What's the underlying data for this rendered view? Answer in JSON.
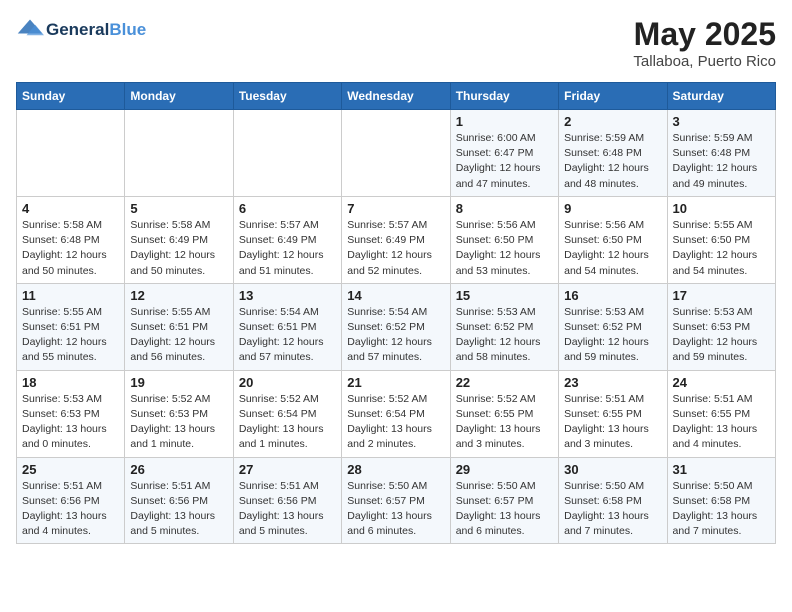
{
  "header": {
    "logo_line1": "General",
    "logo_line2": "Blue",
    "month": "May 2025",
    "location": "Tallaboa, Puerto Rico"
  },
  "weekdays": [
    "Sunday",
    "Monday",
    "Tuesday",
    "Wednesday",
    "Thursday",
    "Friday",
    "Saturday"
  ],
  "weeks": [
    [
      {
        "day": "",
        "info": ""
      },
      {
        "day": "",
        "info": ""
      },
      {
        "day": "",
        "info": ""
      },
      {
        "day": "",
        "info": ""
      },
      {
        "day": "1",
        "info": "Sunrise: 6:00 AM\nSunset: 6:47 PM\nDaylight: 12 hours\nand 47 minutes."
      },
      {
        "day": "2",
        "info": "Sunrise: 5:59 AM\nSunset: 6:48 PM\nDaylight: 12 hours\nand 48 minutes."
      },
      {
        "day": "3",
        "info": "Sunrise: 5:59 AM\nSunset: 6:48 PM\nDaylight: 12 hours\nand 49 minutes."
      }
    ],
    [
      {
        "day": "4",
        "info": "Sunrise: 5:58 AM\nSunset: 6:48 PM\nDaylight: 12 hours\nand 50 minutes."
      },
      {
        "day": "5",
        "info": "Sunrise: 5:58 AM\nSunset: 6:49 PM\nDaylight: 12 hours\nand 50 minutes."
      },
      {
        "day": "6",
        "info": "Sunrise: 5:57 AM\nSunset: 6:49 PM\nDaylight: 12 hours\nand 51 minutes."
      },
      {
        "day": "7",
        "info": "Sunrise: 5:57 AM\nSunset: 6:49 PM\nDaylight: 12 hours\nand 52 minutes."
      },
      {
        "day": "8",
        "info": "Sunrise: 5:56 AM\nSunset: 6:50 PM\nDaylight: 12 hours\nand 53 minutes."
      },
      {
        "day": "9",
        "info": "Sunrise: 5:56 AM\nSunset: 6:50 PM\nDaylight: 12 hours\nand 54 minutes."
      },
      {
        "day": "10",
        "info": "Sunrise: 5:55 AM\nSunset: 6:50 PM\nDaylight: 12 hours\nand 54 minutes."
      }
    ],
    [
      {
        "day": "11",
        "info": "Sunrise: 5:55 AM\nSunset: 6:51 PM\nDaylight: 12 hours\nand 55 minutes."
      },
      {
        "day": "12",
        "info": "Sunrise: 5:55 AM\nSunset: 6:51 PM\nDaylight: 12 hours\nand 56 minutes."
      },
      {
        "day": "13",
        "info": "Sunrise: 5:54 AM\nSunset: 6:51 PM\nDaylight: 12 hours\nand 57 minutes."
      },
      {
        "day": "14",
        "info": "Sunrise: 5:54 AM\nSunset: 6:52 PM\nDaylight: 12 hours\nand 57 minutes."
      },
      {
        "day": "15",
        "info": "Sunrise: 5:53 AM\nSunset: 6:52 PM\nDaylight: 12 hours\nand 58 minutes."
      },
      {
        "day": "16",
        "info": "Sunrise: 5:53 AM\nSunset: 6:52 PM\nDaylight: 12 hours\nand 59 minutes."
      },
      {
        "day": "17",
        "info": "Sunrise: 5:53 AM\nSunset: 6:53 PM\nDaylight: 12 hours\nand 59 minutes."
      }
    ],
    [
      {
        "day": "18",
        "info": "Sunrise: 5:53 AM\nSunset: 6:53 PM\nDaylight: 13 hours\nand 0 minutes."
      },
      {
        "day": "19",
        "info": "Sunrise: 5:52 AM\nSunset: 6:53 PM\nDaylight: 13 hours\nand 1 minute."
      },
      {
        "day": "20",
        "info": "Sunrise: 5:52 AM\nSunset: 6:54 PM\nDaylight: 13 hours\nand 1 minutes."
      },
      {
        "day": "21",
        "info": "Sunrise: 5:52 AM\nSunset: 6:54 PM\nDaylight: 13 hours\nand 2 minutes."
      },
      {
        "day": "22",
        "info": "Sunrise: 5:52 AM\nSunset: 6:55 PM\nDaylight: 13 hours\nand 3 minutes."
      },
      {
        "day": "23",
        "info": "Sunrise: 5:51 AM\nSunset: 6:55 PM\nDaylight: 13 hours\nand 3 minutes."
      },
      {
        "day": "24",
        "info": "Sunrise: 5:51 AM\nSunset: 6:55 PM\nDaylight: 13 hours\nand 4 minutes."
      }
    ],
    [
      {
        "day": "25",
        "info": "Sunrise: 5:51 AM\nSunset: 6:56 PM\nDaylight: 13 hours\nand 4 minutes."
      },
      {
        "day": "26",
        "info": "Sunrise: 5:51 AM\nSunset: 6:56 PM\nDaylight: 13 hours\nand 5 minutes."
      },
      {
        "day": "27",
        "info": "Sunrise: 5:51 AM\nSunset: 6:56 PM\nDaylight: 13 hours\nand 5 minutes."
      },
      {
        "day": "28",
        "info": "Sunrise: 5:50 AM\nSunset: 6:57 PM\nDaylight: 13 hours\nand 6 minutes."
      },
      {
        "day": "29",
        "info": "Sunrise: 5:50 AM\nSunset: 6:57 PM\nDaylight: 13 hours\nand 6 minutes."
      },
      {
        "day": "30",
        "info": "Sunrise: 5:50 AM\nSunset: 6:58 PM\nDaylight: 13 hours\nand 7 minutes."
      },
      {
        "day": "31",
        "info": "Sunrise: 5:50 AM\nSunset: 6:58 PM\nDaylight: 13 hours\nand 7 minutes."
      }
    ]
  ]
}
